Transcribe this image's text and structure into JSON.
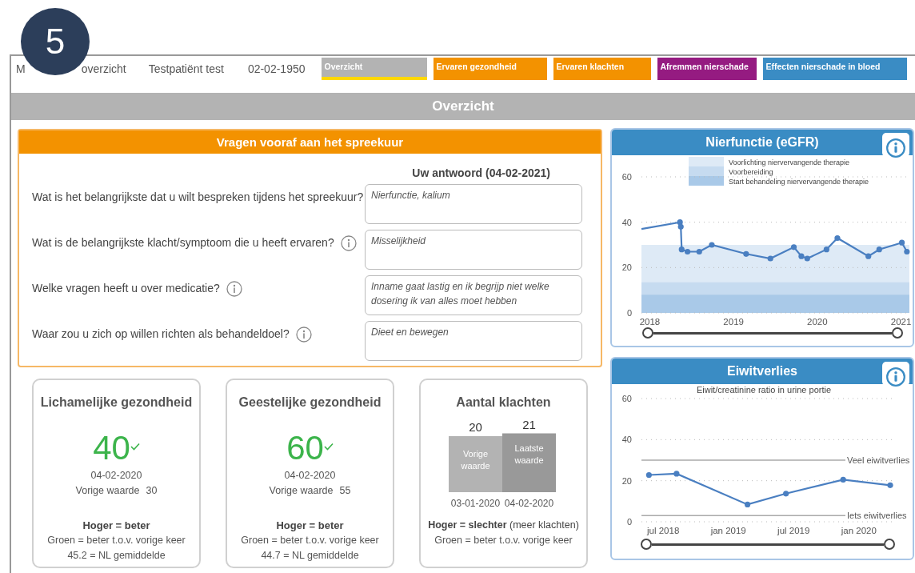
{
  "badge": {
    "text": "5"
  },
  "header": {
    "title_parts": [
      "M",
      "overzicht"
    ],
    "patient": "Testpatiënt test",
    "birth_date": "02-02-1950"
  },
  "tabs": [
    {
      "label": "Overzicht",
      "selected": true,
      "color": "#b3b3b3"
    },
    {
      "label": "Ervaren gezondheid",
      "selected": false,
      "color": "#f39200"
    },
    {
      "label": "Ervaren klachten",
      "selected": false,
      "color": "#f39200"
    },
    {
      "label": "Afremmen nierschade",
      "selected": false,
      "color": "#951b81"
    },
    {
      "label": "Effecten nierschade in bloed",
      "selected": false,
      "color": "#3a8cc4"
    }
  ],
  "page_title": "Overzicht",
  "questions_card": {
    "title": "Vragen vooraf aan het spreekuur",
    "answer_heading": "Uw antwoord (04-02-2021)",
    "rows": [
      {
        "question": "Wat is het belangrijkste dat u wilt bespreken tijdens het spreekuur?",
        "info": false,
        "answer": "Nierfunctie, kalium"
      },
      {
        "question": "Wat is de belangrijkste klacht/symptoom die u heeft ervaren?",
        "info": true,
        "answer": "Misselijkheid"
      },
      {
        "question": "Welke vragen heeft u over medicatie?",
        "info": true,
        "answer": "Inname gaat lastig en ik begrijp niet welke dosering ik van alles moet hebben"
      },
      {
        "question": "Waar zou u zich op willen richten als behandeldoel?",
        "info": true,
        "answer": "Dieet en bewegen"
      }
    ]
  },
  "score_cards": [
    {
      "kind": "score",
      "title": "Lichamelijke gezondheid",
      "score": "40",
      "improved": true,
      "date": "04-02-2020",
      "previous_label": "Vorige waarde",
      "previous_value": "30",
      "rule": "Hoger = beter",
      "notes": [
        "Groen = beter t.o.v. vorige keer",
        "45.2  = NL gemiddelde"
      ]
    },
    {
      "kind": "score",
      "title": "Geestelijke gezondheid",
      "score": "60",
      "improved": true,
      "date": "04-02-2020",
      "previous_label": "Vorige waarde",
      "previous_value": "55",
      "rule": "Hoger = beter",
      "notes": [
        "Groen = beter t.o.v. vorige keer",
        "44.7  = NL gemiddelde"
      ]
    },
    {
      "kind": "bars",
      "title": "Aantal klachten",
      "chart_data": {
        "type": "bar",
        "categories": [
          "03-01-2020",
          "04-02-2020"
        ],
        "series": [
          {
            "color": "#b3b3b3",
            "values": [
              20,
              null
            ]
          },
          {
            "color": "#999999",
            "values": [
              null,
              21
            ]
          }
        ],
        "stacked": true,
        "data_labels": true,
        "annotations": [
          "Vorige waarde",
          "Laatste waarde"
        ]
      },
      "rule": "**Hoger = slechter** (meer klachten)",
      "notes": [
        "Groen = beter t.o.v. vorige keer"
      ]
    }
  ],
  "egfr_panel": {
    "title": "Nierfunctie (eGFR)",
    "chart_data": {
      "type": "line",
      "x": [
        2017.9,
        2018.36,
        2018.37,
        2018.38,
        2018.45,
        2018.59,
        2018.74,
        2019.15,
        2019.44,
        2019.72,
        2019.81,
        2019.88,
        2020.11,
        2020.24,
        2020.61,
        2020.74,
        2021.01,
        2021.07
      ],
      "series": [
        {
          "color": "#4a7fc1",
          "marker": true,
          "values": [
            37,
            40,
            38,
            28,
            27,
            27,
            30,
            26,
            24,
            29,
            25,
            24,
            28,
            33,
            25,
            28,
            31,
            27
          ]
        }
      ],
      "legend": "top",
      "xlim": [
        2017.9,
        2021.1
      ],
      "ylim": [
        0,
        60
      ],
      "xticks": [
        2018,
        2019,
        2020,
        2021
      ],
      "yticks": [
        0,
        20,
        40,
        60
      ],
      "bands": [
        {
          "axis": "y",
          "label": "Voorlichting niervervangende therapie",
          "from": 0,
          "to": 30,
          "color": "#deeaf6"
        },
        {
          "axis": "y",
          "label": "Voorbereiding",
          "from": 0,
          "to": 13.5,
          "color": "#c6dbf0"
        },
        {
          "axis": "y",
          "label": "Start behandeling niervervangende therapie",
          "from": 0,
          "to": 8,
          "color": "#a9c9e8"
        }
      ]
    },
    "slider": {
      "level": 1
    }
  },
  "protein_panel": {
    "title": "Eiwitverlies",
    "chart_data": {
      "type": "line",
      "title": "Eiwit/creatinine ratio in urine portie",
      "x": [
        "2018-05-22",
        "2018-08-08",
        "2019-02-24",
        "2019-06-10",
        "2019-11-18",
        "2020-03-28"
      ],
      "series": [
        {
          "color": "#4a7fc1",
          "marker": true,
          "values": [
            22.8,
            23.4,
            8.4,
            13.7,
            20.5,
            17.8
          ]
        }
      ],
      "xlim": [
        "2018-05-01",
        "2020-04-11"
      ],
      "ylim": [
        0,
        60
      ],
      "xticks": [
        {
          "value": "2018-07-01",
          "label": "jul 2018"
        },
        {
          "value": "2019-01-01",
          "label": "jan 2019"
        },
        {
          "value": "2019-07-01",
          "label": "jul 2019"
        },
        {
          "value": "2020-01-01",
          "label": "jan 2020"
        }
      ],
      "yticks": [
        0,
        20,
        40,
        60
      ],
      "ref_lines": [
        {
          "axis": "y",
          "label": "Veel eiwitverlies",
          "value": 30
        },
        {
          "axis": "y",
          "label": "Iets eiwitverlies",
          "value": 3
        }
      ]
    },
    "slider": {
      "level": 1
    }
  }
}
